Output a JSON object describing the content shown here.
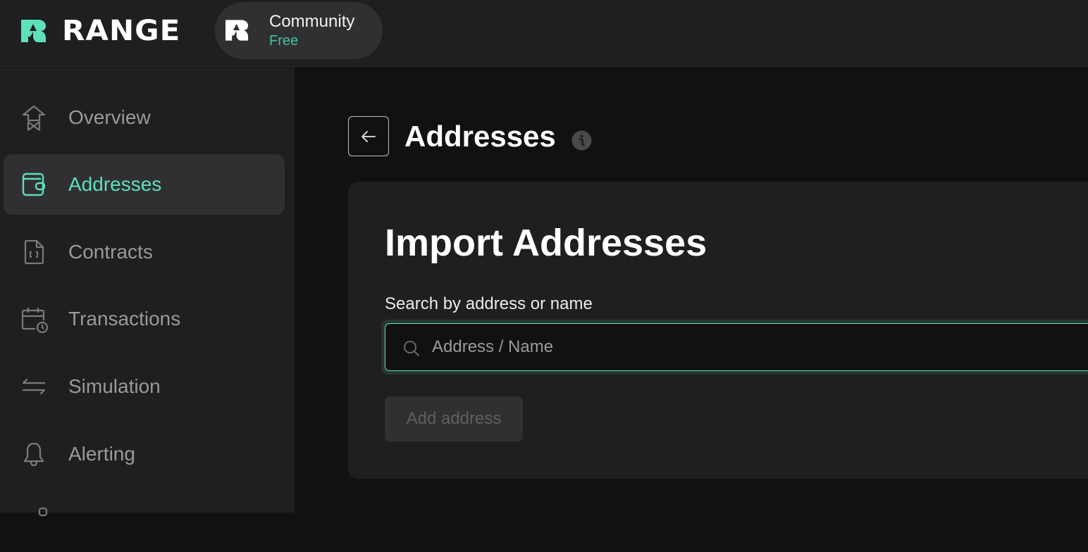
{
  "brand": {
    "name": "RANGE",
    "accent_color": "#5ee0b8",
    "logo_icon": "range-logo-icon"
  },
  "plan": {
    "name": "Community",
    "tier": "Free",
    "tier_color": "#3ec59a"
  },
  "sidebar": {
    "items": [
      {
        "label": "Overview",
        "icon": "overview-icon",
        "active": false
      },
      {
        "label": "Addresses",
        "icon": "wallet-icon",
        "active": true
      },
      {
        "label": "Contracts",
        "icon": "contract-file-icon",
        "active": false
      },
      {
        "label": "Transactions",
        "icon": "calendar-clock-icon",
        "active": false
      },
      {
        "label": "Simulation",
        "icon": "arrows-exchange-icon",
        "active": false
      },
      {
        "label": "Alerting",
        "icon": "bell-icon",
        "active": false
      }
    ]
  },
  "header": {
    "title": "Addresses",
    "back_icon": "arrow-left-icon",
    "info_icon": "info-icon"
  },
  "import_card": {
    "title": "Import Addresses",
    "search_label": "Search by address or name",
    "search_placeholder": "Address / Name",
    "search_value": "",
    "add_button_label": "Add address",
    "add_button_disabled": true
  }
}
